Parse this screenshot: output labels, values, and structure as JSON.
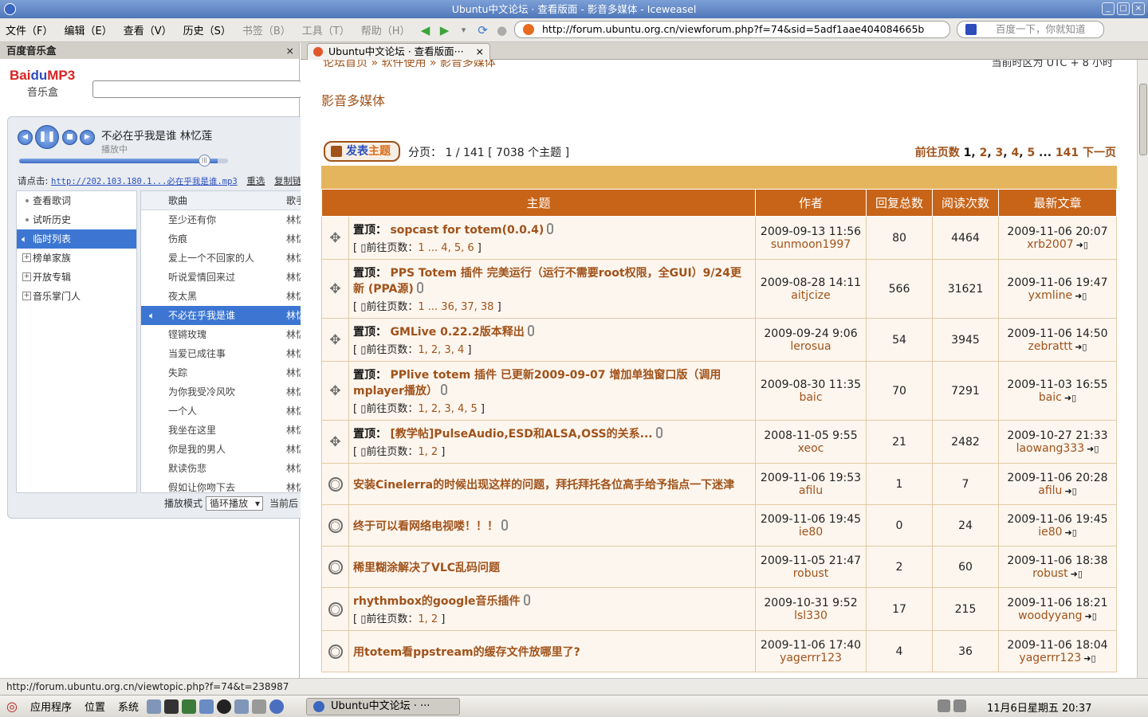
{
  "window": {
    "title": "Ubuntu中文论坛 · 查看版面 - 影音多媒体 - Iceweasel"
  },
  "menu": [
    "文件（F）",
    "编辑（E）",
    "查看（V）",
    "历史（S）",
    "书签（B）",
    "工具（T）",
    "帮助（H）"
  ],
  "url": "http://forum.ubuntu.org.cn/viewforum.php?f=74&sid=5adf1aae404084665b",
  "search": {
    "placeholder": "百度一下，你就知道"
  },
  "sidebar": {
    "title": "百度音乐盒",
    "logo": {
      "brand": "Bai",
      "du": "du",
      "mp3": "MP3",
      "sub": "音乐盒"
    },
    "player": {
      "song": "不必在乎我是谁  林忆莲",
      "state": "播放中",
      "progress": 0.95,
      "link_label": "请点击:",
      "link": "http://202.103.180.1...必在乎我是谁.mp3",
      "reselect": "重选",
      "copy": "复制链"
    },
    "nav": [
      "查看歌词",
      "试听历史",
      "临时列表",
      "榜单家族",
      "开放专辑",
      "音乐掌门人"
    ],
    "list_headers": {
      "song": "歌曲",
      "artist": "歌手"
    },
    "songs": [
      {
        "name": "至少还有你",
        "artist": "林忆"
      },
      {
        "name": "伤痕",
        "artist": "林忆"
      },
      {
        "name": "爱上一个不回家的人",
        "artist": "林忆"
      },
      {
        "name": "听说爱情回来过",
        "artist": "林忆"
      },
      {
        "name": "夜太黑",
        "artist": "林忆"
      },
      {
        "name": "不必在乎我是谁",
        "artist": "林忆"
      },
      {
        "name": "铿锵玫瑰",
        "artist": "林忆"
      },
      {
        "name": "当爱已成往事",
        "artist": "林忆"
      },
      {
        "name": "失踪",
        "artist": "林忆"
      },
      {
        "name": "为你我受冷风吹",
        "artist": "林忆"
      },
      {
        "name": "一个人",
        "artist": "林忆"
      },
      {
        "name": "我坐在这里",
        "artist": "林忆"
      },
      {
        "name": "你是我的男人",
        "artist": "林忆"
      },
      {
        "name": "默读伤悲",
        "artist": "林忆"
      },
      {
        "name": "假如让你吻下去",
        "artist": "林忆"
      }
    ],
    "mode_label": "播放模式",
    "mode_value": "循环播放",
    "current_label": "当前后"
  },
  "tab": {
    "label": "Ubuntu中文论坛 · 查看版面···"
  },
  "page": {
    "breadcrumb": "论坛首页 » 软件使用 » 影音多媒体",
    "timezone": "当前时区为 UTC + 8 小时",
    "forum_title": "影音多媒体",
    "post_btn": {
      "a": "发表",
      "b": "主题"
    },
    "page_info": "分页：  1 / 141  [ 7038 个主题 ]",
    "pagenav": {
      "label": "前往页数",
      "pages": [
        "1",
        "2",
        "3",
        "4",
        "5",
        "141"
      ],
      "next": "下一页"
    },
    "headers": {
      "topic": "主题",
      "author": "作者",
      "replies": "回复总数",
      "views": "阅读次数",
      "last": "最新文章"
    },
    "pin_label": "置顶：",
    "goto_label": "[ ▯前往页数：",
    "topics": [
      {
        "sticky": true,
        "title": "sopcast for totem(0.0.4)",
        "clip": true,
        "pages": "1 ... 4, 5, 6",
        "date": "2009-09-13 11:56",
        "author": "sunmoon1997",
        "replies": "80",
        "views": "4464",
        "last_date": "2009-11-06 20:07",
        "last_author": "xrb2007"
      },
      {
        "sticky": true,
        "title": "PPS Totem 插件 完美运行（运行不需要root权限，全GUI）9/24更新 (PPA源)",
        "clip": true,
        "pages": "1 ... 36, 37, 38",
        "date": "2009-08-28 14:11",
        "author": "aitjcize",
        "replies": "566",
        "views": "31621",
        "last_date": "2009-11-06 19:47",
        "last_author": "yxmline"
      },
      {
        "sticky": true,
        "title": "GMLive 0.22.2版本释出",
        "clip": true,
        "pages": "1, 2, 3, 4",
        "date": "2009-09-24 9:06",
        "author": "lerosua",
        "replies": "54",
        "views": "3945",
        "last_date": "2009-11-06 14:50",
        "last_author": "zebrattt"
      },
      {
        "sticky": true,
        "title": "PPlive totem 插件 已更新2009-09-07 增加单独窗口版（调用mplayer播放）",
        "clip": true,
        "pages": "1, 2, 3, 4, 5",
        "date": "2009-08-30 11:35",
        "author": "baic",
        "replies": "70",
        "views": "7291",
        "last_date": "2009-11-03 16:55",
        "last_author": "baic"
      },
      {
        "sticky": true,
        "title": "[教学帖]PulseAudio,ESD和ALSA,OSS的关系...",
        "clip": true,
        "pages": "1, 2",
        "date": "2008-11-05 9:55",
        "author": "xeoc",
        "replies": "21",
        "views": "2482",
        "last_date": "2009-10-27 21:33",
        "last_author": "laowang333"
      },
      {
        "sticky": false,
        "title": "安装Cinelerra的时候出现这样的问题，拜托拜托各位高手给予指点一下迷津",
        "clip": false,
        "pages": "",
        "date": "2009-11-06 19:53",
        "author": "afilu",
        "replies": "1",
        "views": "7",
        "last_date": "2009-11-06 20:28",
        "last_author": "afilu"
      },
      {
        "sticky": false,
        "title": "终于可以看网络电视喽！！！",
        "clip": true,
        "pages": "",
        "date": "2009-11-06 19:45",
        "author": "ie80",
        "replies": "0",
        "views": "24",
        "last_date": "2009-11-06 19:45",
        "last_author": "ie80"
      },
      {
        "sticky": false,
        "title": "稀里糊涂解决了VLC乱码问题",
        "clip": false,
        "pages": "",
        "date": "2009-11-05 21:47",
        "author": "robust",
        "replies": "2",
        "views": "60",
        "last_date": "2009-11-06 18:38",
        "last_author": "robust"
      },
      {
        "sticky": false,
        "title": "rhythmbox的google音乐插件",
        "clip": true,
        "pages": "1, 2",
        "date": "2009-10-31 9:52",
        "author": "lsl330",
        "replies": "17",
        "views": "215",
        "last_date": "2009-11-06 18:21",
        "last_author": "woodyyang"
      },
      {
        "sticky": false,
        "title": "用totem看ppstream的缓存文件放哪里了?",
        "clip": false,
        "pages": "",
        "date": "2009-11-06 17:40",
        "author": "yagerrr123",
        "replies": "4",
        "views": "36",
        "last_date": "2009-11-06 18:04",
        "last_author": "yagerrr123"
      }
    ]
  },
  "status": "http://forum.ubuntu.org.cn/viewtopic.php?f=74&t=238987",
  "taskbar": {
    "apps": "应用程序",
    "places": "位置",
    "system": "系统",
    "task": "Ubuntu中文论坛 · ···",
    "clock": "11月6日星期五 20:37"
  },
  "colors": {
    "accent": "#c86418",
    "link": "#a0521a",
    "band": "#e5b55e",
    "row": "#fdf6ee"
  }
}
